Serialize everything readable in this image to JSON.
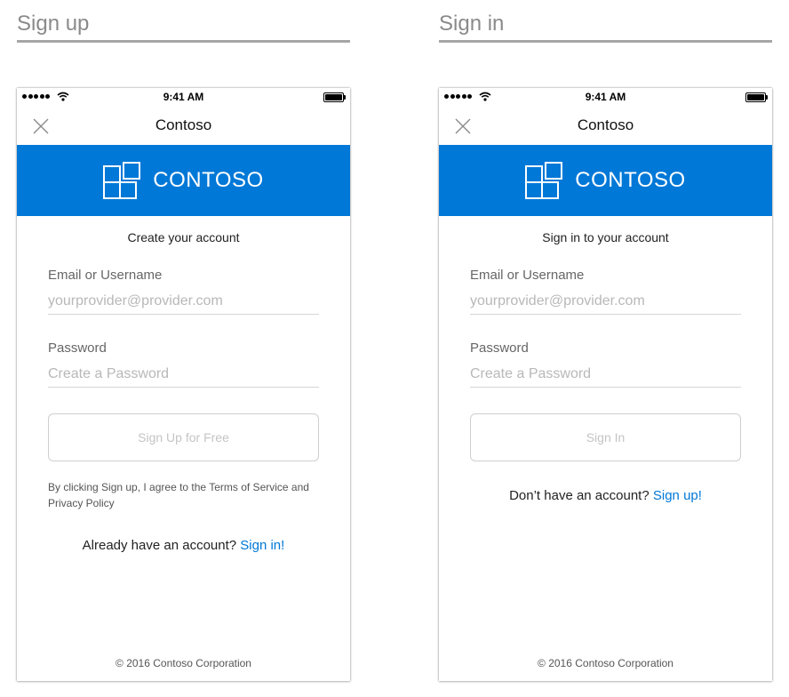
{
  "signup_section": {
    "title": "Sign up",
    "phone": {
      "status_time": "9:41 AM",
      "nav_title": "Contoso",
      "brand_name": "CONTOSO",
      "heading": "Create your account",
      "email_label": "Email or Username",
      "email_placeholder": "yourprovider@provider.com",
      "password_label": "Password",
      "password_placeholder": "Create a Password",
      "button_label": "Sign Up for Free",
      "terms_text": "By clicking Sign up, I agree to the Terms of Service and Privacy Policy",
      "switch_prompt": "Already have an account?",
      "switch_link": "Sign in!",
      "footer": "© 2016 Contoso Corporation"
    }
  },
  "signin_section": {
    "title": "Sign in",
    "phone": {
      "status_time": "9:41 AM",
      "nav_title": "Contoso",
      "brand_name": "CONTOSO",
      "heading": "Sign in to your account",
      "email_label": "Email or Username",
      "email_placeholder": "yourprovider@provider.com",
      "password_label": "Password",
      "password_placeholder": "Create a Password",
      "button_label": "Sign In",
      "switch_prompt": "Don’t have an account?",
      "switch_link": "Sign up!",
      "footer": "© 2016 Contoso Corporation"
    }
  },
  "colors": {
    "brand_blue": "#0078d7",
    "section_title": "#8a8a8a",
    "placeholder": "#b8b8b8"
  },
  "icons": {
    "signal": "signal-dots-icon",
    "wifi": "wifi-icon",
    "battery": "battery-icon",
    "close": "close-icon",
    "logo": "contoso-logo-icon"
  }
}
